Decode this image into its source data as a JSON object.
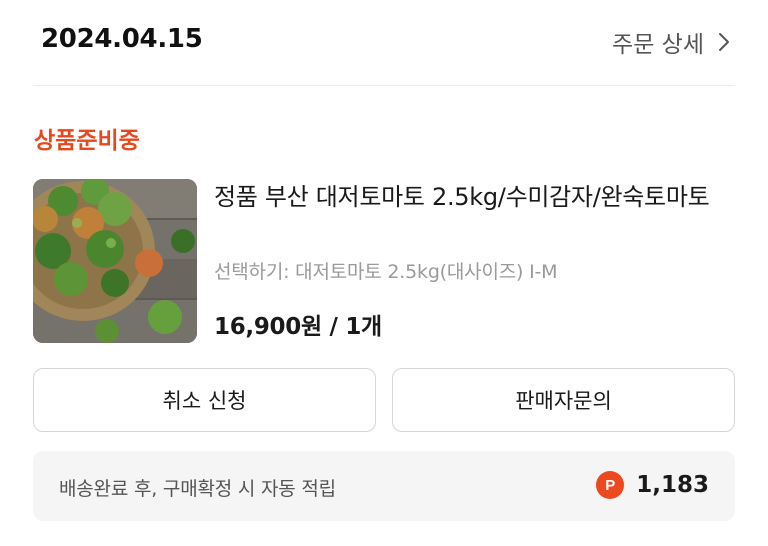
{
  "order": {
    "date": "2024.04.15",
    "detail_link_label": "주문 상세"
  },
  "status": {
    "label": "상품준비중",
    "color": "#e8481c"
  },
  "product": {
    "name": "정품 부산 대저토마토 2.5kg/수미감자/완숙토마토",
    "option": "선택하기: 대저토마토 2.5kg(대사이즈) I-M",
    "price_quantity": "16,900원 / 1개",
    "image": "tomato-basket-thumbnail"
  },
  "actions": {
    "cancel_label": "취소 신청",
    "inquiry_label": "판매자문의"
  },
  "points": {
    "description": "배송완료 후, 구매확정 시 자동 적립",
    "badge_letter": "P",
    "value": "1,183",
    "badge_color": "#ec4a1e"
  },
  "icons": {
    "detail_chevron": "chevron-right-icon"
  }
}
